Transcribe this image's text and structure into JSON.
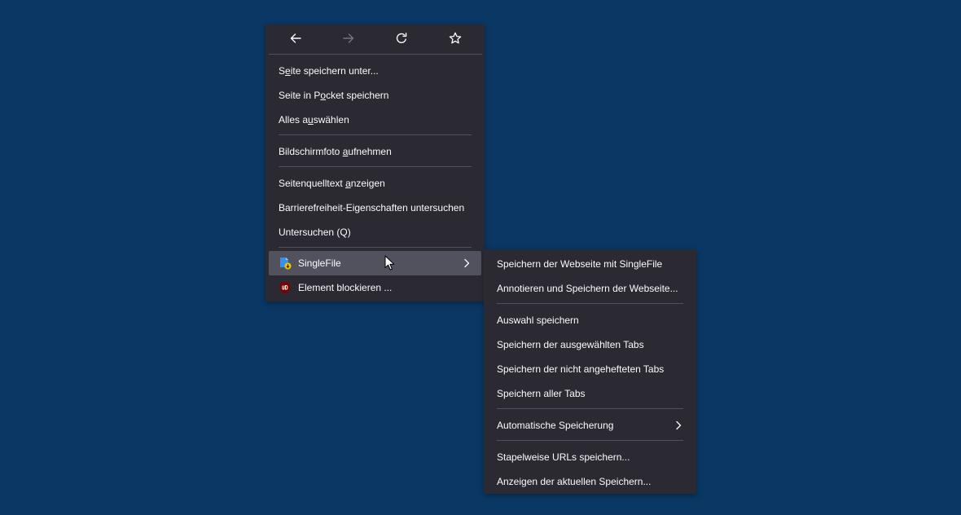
{
  "main_menu": {
    "nav": {
      "back_icon": "arrow-left",
      "forward_icon": "arrow-right-disabled",
      "reload_icon": "reload",
      "bookmark_icon": "star-outline"
    },
    "items": [
      {
        "pre": "S",
        "accel": "e",
        "post": "ite speichern unter..."
      },
      {
        "pre": "Seite in P",
        "accel": "o",
        "post": "cket speichern"
      },
      {
        "pre": "Alles a",
        "accel": "u",
        "post": "swählen"
      },
      {
        "pre": "Bildschirmfoto ",
        "accel": "a",
        "post": "ufnehmen"
      },
      {
        "pre": "Seitenquelltext ",
        "accel": "a",
        "post": "nzeigen"
      },
      {
        "pre": "Barrierefreiheit-Eigenschaften untersuchen",
        "accel": "",
        "post": ""
      },
      {
        "pre": "Untersuchen (Q)",
        "accel": "",
        "post": ""
      },
      {
        "label": "SingleFile"
      },
      {
        "label": "Element blockieren ..."
      }
    ]
  },
  "sub_menu": {
    "items": [
      "Speichern der Webseite mit SingleFile",
      "Annotieren und Speichern der Webseite...",
      "Auswahl speichern",
      "Speichern der ausgewählten Tabs",
      "Speichern der nicht angehefteten Tabs",
      "Speichern aller Tabs",
      "Automatische Speicherung",
      "Stapelweise URLs speichern...",
      "Anzeigen der aktuellen Speichern..."
    ]
  },
  "colors": {
    "desktop_bg": "#0a3764",
    "menu_bg": "#2b2a33",
    "menu_text": "#fbfbfe",
    "highlight_bg": "#52525e",
    "separator": "#52525e",
    "ublock_red": "#800000"
  }
}
